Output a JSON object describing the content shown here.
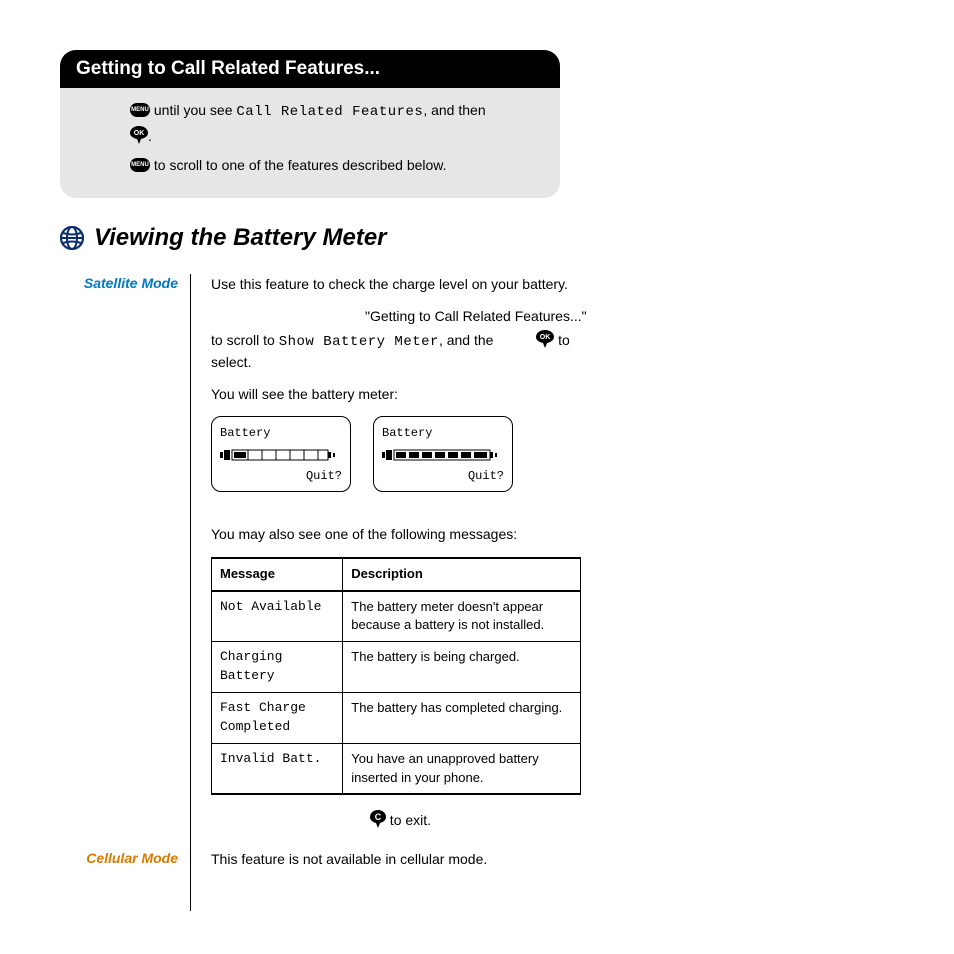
{
  "header": {
    "title": "Getting to Call Related Features..."
  },
  "graybox": {
    "line1_prefix": " until you see ",
    "line1_lcd": "Call Related Features",
    "line1_suffix": ", and then ",
    "line1_end": ".",
    "line2": " to scroll to one of the features described below."
  },
  "section": {
    "title": "Viewing the Battery Meter"
  },
  "satellite": {
    "label": "Satellite Mode",
    "p1": "Use this feature to check the charge level on your battery.",
    "p2_pre": "\"Getting to Call Related Features...\" to scroll to ",
    "p2_lcd": "Show Battery Meter",
    "p2_mid": ", and the ",
    "p2_end": " to select.",
    "p3": "You will see the battery meter:",
    "screen1": {
      "top": "Battery",
      "bottom": "Quit?"
    },
    "screen2": {
      "top": "Battery",
      "bottom": "Quit?"
    },
    "p4": "You may also see one of the following messages:",
    "table": {
      "h1": "Message",
      "h2": "Description",
      "rows": [
        {
          "msg": "Not Available",
          "desc": "The battery meter doesn't appear because a battery is not installed."
        },
        {
          "msg": "Charging Battery",
          "desc": "The battery is being charged."
        },
        {
          "msg": "Fast Charge Completed",
          "desc": "The battery has completed charging."
        },
        {
          "msg": "Invalid Batt.",
          "desc": "You have an unapproved battery inserted in your phone."
        }
      ]
    },
    "exit": " to exit."
  },
  "cellular": {
    "label": "Cellular Mode",
    "text": "This feature is not available in cellular mode."
  }
}
